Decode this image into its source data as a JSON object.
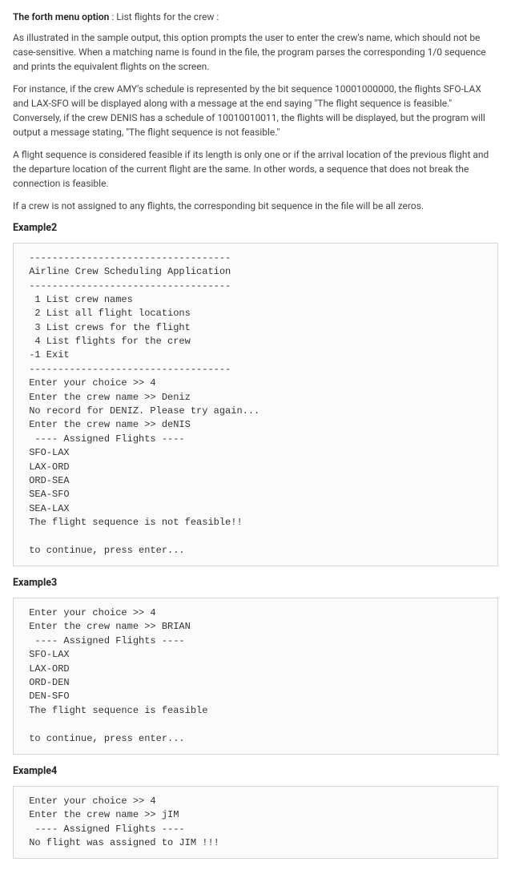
{
  "intro": {
    "bold": "The forth menu option",
    "rest": " : List flights for the crew :"
  },
  "paragraphs": [
    "As illustrated in the sample output, this option prompts the user to enter the crew's name, which should not be case-sensitive. When a matching name is found in the file, the program parses the corresponding 1/0 sequence and prints the equivalent flights on the screen.",
    "For instance, if the crew AMY's schedule is represented by the bit sequence 10001000000, the flights SFO-LAX and LAX-SFO will be displayed along with a message at the end saying \"The flight sequence is feasible.\" Conversely, if the crew DENIS has a schedule of 10010010011, the flights will be displayed, but the program will output a message stating, \"The flight sequence is not feasible.\"",
    "A flight sequence is considered feasible if its length is only one or if the arrival location of the previous flight and the departure location of the current flight are the same. In other words, a sequence that does not break the connection is feasible.",
    "If a crew is not assigned to any flights, the corresponding bit sequence in the file will be all zeros."
  ],
  "examples": [
    {
      "heading": "Example2",
      "code": " -----------------------------------\n Airline Crew Scheduling Application\n -----------------------------------\n  1 List crew names\n  2 List all flight locations\n  3 List crews for the flight\n  4 List flights for the crew\n -1 Exit\n -----------------------------------\n Enter your choice >> 4\n Enter the crew name >> Deniz\n No record for DENIZ. Please try again...\n Enter the crew name >> deNIS\n  ---- Assigned Flights ----\n SFO-LAX\n LAX-ORD\n ORD-SEA\n SEA-SFO\n SEA-LAX\n The flight sequence is not feasible!!\n\n to continue, press enter..."
    },
    {
      "heading": "Example3",
      "code": " Enter your choice >> 4\n Enter the crew name >> BRIAN\n  ---- Assigned Flights ----\n SFO-LAX\n LAX-ORD\n ORD-DEN\n DEN-SFO\n The flight sequence is feasible\n\n to continue, press enter..."
    },
    {
      "heading": "Example4",
      "code": " Enter your choice >> 4\n Enter the crew name >> jIM\n  ---- Assigned Flights ----\n No flight was assigned to JIM !!!"
    }
  ]
}
